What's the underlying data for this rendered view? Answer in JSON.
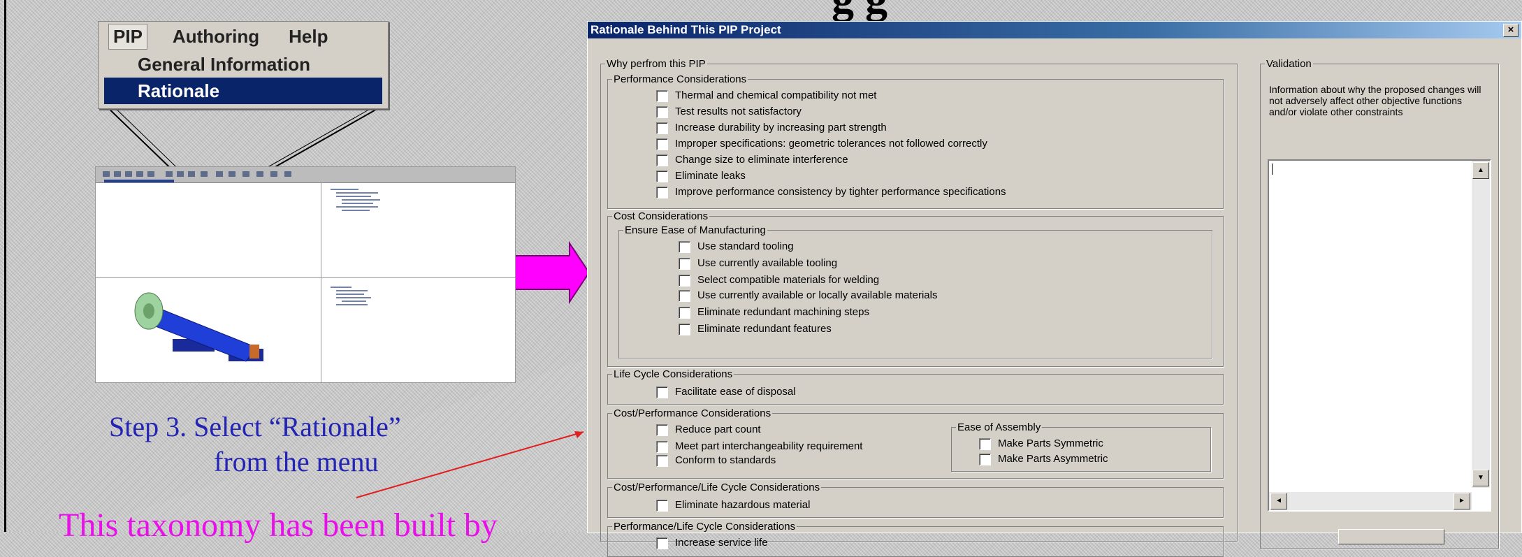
{
  "slide": {
    "title_fragment": "g      g",
    "step_line1": "Step 3.  Select “Rationale”",
    "step_line2": "from the menu",
    "taxonomy_text": "This taxonomy has been built by"
  },
  "menu": {
    "bar": [
      "PIP",
      "Authoring",
      "Help"
    ],
    "items": [
      "General Information",
      "Rationale"
    ],
    "selected": "Rationale"
  },
  "dialog": {
    "title": "Rationale Behind This PIP Project",
    "close": "×",
    "why_legend": "Why perfrom this PIP",
    "performance": {
      "legend": "Performance Considerations",
      "items": [
        "Thermal and chemical compatibility not met",
        "Test results not satisfactory",
        "Increase durability by increasing part strength",
        "Improper specifications: geometric tolerances not followed correctly",
        "Change size to eliminate interference",
        "Eliminate leaks",
        "Improve performance consistency by tighter performance specifications"
      ]
    },
    "cost": {
      "legend": "Cost Considerations",
      "manufacturing_legend": "Ensure Ease of Manufacturing",
      "items": [
        "Use standard tooling",
        "Use currently available tooling",
        "Select compatible materials for welding",
        "Use currently available or locally available materials",
        "Eliminate redundant machining steps",
        "Eliminate redundant features"
      ]
    },
    "life_cycle": {
      "legend": "Life Cycle Considerations",
      "items": [
        "Facilitate ease of disposal"
      ]
    },
    "cost_perf": {
      "legend": "Cost/Performance Considerations",
      "items": [
        "Reduce part count",
        "Meet part interchangeability requirement",
        "Conform to standards"
      ],
      "assembly_legend": "Ease of Assembly",
      "assembly_items": [
        "Make Parts Symmetric",
        "Make Parts Asymmetric"
      ]
    },
    "cost_perf_life": {
      "legend": "Cost/Performance/Life Cycle Considerations",
      "items": [
        "Eliminate hazardous material"
      ]
    },
    "perf_life": {
      "legend": "Performance/Life Cycle Considerations",
      "items": [
        "Increase service life"
      ]
    },
    "validation": {
      "legend": "Validation",
      "text": "Information about why the proposed changes will not adversely affect other objective functions and/or violate other constraints"
    }
  },
  "colors": {
    "step": "#2323b4",
    "taxonomy": "#e810e8",
    "arrow": "#ff00ff",
    "title_bar": "#0a246a"
  }
}
